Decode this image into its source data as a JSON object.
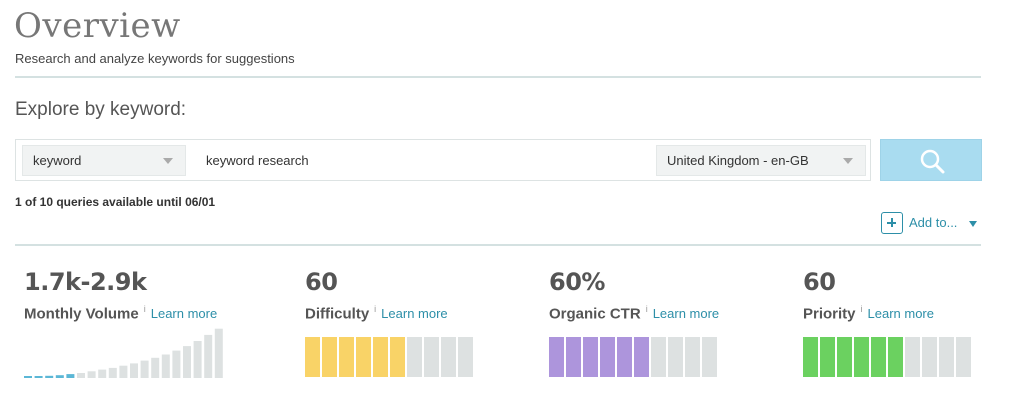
{
  "header": {
    "title": "Overview",
    "subtitle": "Research and analyze keywords for suggestions"
  },
  "explore": {
    "heading": "Explore by keyword:",
    "type_select": "keyword",
    "query_value": "keyword research",
    "location_select": "United Kingdom - en-GB",
    "queries_note": "1 of 10 queries available until 06/01"
  },
  "actions": {
    "add_to_label": "Add to..."
  },
  "metrics": {
    "volume": {
      "value": "1.7k-2.9k",
      "name": "Monthly Volume",
      "info": "i",
      "learn": "Learn more",
      "color": "#5bb7d6"
    },
    "difficulty": {
      "value": "60",
      "name": "Difficulty",
      "info": "i",
      "learn": "Learn more",
      "filled": 6,
      "total": 10,
      "color": "#f9d367"
    },
    "ctr": {
      "value": "60%",
      "name": "Organic CTR",
      "info": "i",
      "learn": "Learn more",
      "filled": 6,
      "total": 10,
      "color": "#ad95dc"
    },
    "priority": {
      "value": "60",
      "name": "Priority",
      "info": "i",
      "learn": "Learn more",
      "filled": 6,
      "total": 10,
      "color": "#6bd160"
    }
  },
  "colors": {
    "accent": "#2d8fa8",
    "empty_segment": "#dde1e1",
    "search_button": "#a9dcf0"
  },
  "icons": {
    "search_button": "search-icon",
    "add_to": "plus-icon",
    "dropdown": "chevron-down-icon"
  },
  "volume_trend": {
    "filled_bars": 5,
    "bar_fractions": [
      0.03,
      0.03,
      0.04,
      0.05,
      0.07,
      0.09,
      0.12,
      0.15,
      0.18,
      0.22,
      0.26,
      0.31,
      0.36,
      0.42,
      0.49,
      0.57,
      0.66,
      0.77,
      0.88
    ]
  }
}
